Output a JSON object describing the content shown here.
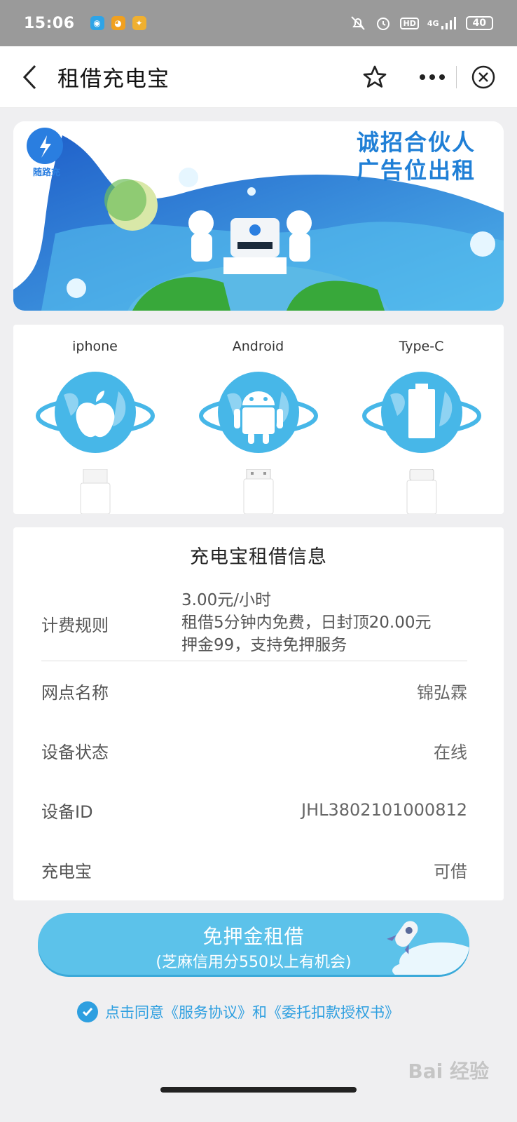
{
  "status_bar": {
    "time": "15:06",
    "network": "4G",
    "hd": "HD",
    "battery": "40"
  },
  "nav": {
    "title": "租借充电宝"
  },
  "banner": {
    "brand": "随路充",
    "line1": "诚招合伙人",
    "line2": "广告位出租"
  },
  "cables": [
    {
      "label": "iphone",
      "icon": "apple-icon"
    },
    {
      "label": "Android",
      "icon": "android-icon"
    },
    {
      "label": "Type-C",
      "icon": "battery-icon"
    }
  ],
  "info": {
    "title": "充电宝租借信息",
    "fee_label": "计费规则",
    "fee_lines": [
      "3.00元/小时",
      "租借5分钟内免费，日封顶20.00元",
      "押金99，支持免押服务"
    ],
    "rows": [
      {
        "label": "网点名称",
        "value": "锦弘霖"
      },
      {
        "label": "设备状态",
        "value": "在线"
      },
      {
        "label": "设备ID",
        "value": "JHL3802101000812"
      },
      {
        "label": "充电宝",
        "value": "可借"
      }
    ]
  },
  "rent_button": {
    "main": "免押金租借",
    "sub": "(芝麻信用分550以上有机会)"
  },
  "agreement": {
    "text": "点击同意《服务协议》和《委托扣款授权书》"
  },
  "watermark": "Bai 经验",
  "colors": {
    "accent": "#5cc2ea",
    "link": "#2e9fe0",
    "banner_text": "#1f7fd6"
  }
}
